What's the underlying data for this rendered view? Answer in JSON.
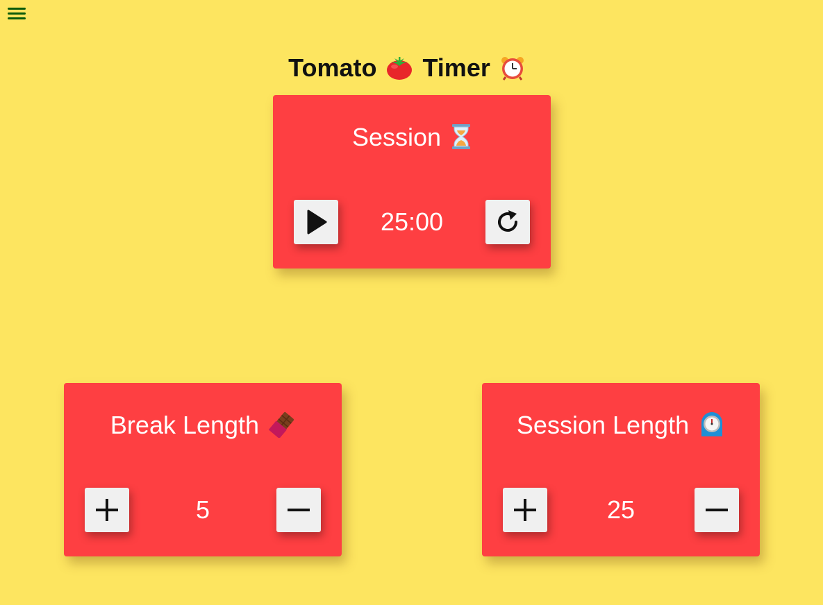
{
  "header": {
    "title_word_1": "Tomato",
    "title_word_2": "Timer",
    "tomato_icon": "tomato-icon",
    "alarm_icon": "alarm-clock-icon"
  },
  "menu": {
    "icon": "hamburger-menu-icon",
    "color": "#0a5a0a"
  },
  "session": {
    "label": "Session",
    "icon": "hourglass-icon",
    "time": "25:00",
    "play_icon": "play-icon",
    "reset_icon": "refresh-icon"
  },
  "break_length": {
    "label": "Break Length",
    "icon": "chocolate-bar-icon",
    "value": "5",
    "increment_icon": "plus-icon",
    "decrement_icon": "minus-icon"
  },
  "session_length": {
    "label": "Session Length",
    "icon": "stopwatch-icon",
    "value": "25",
    "increment_icon": "plus-icon",
    "decrement_icon": "minus-icon"
  },
  "colors": {
    "background": "#fde560",
    "card": "#fe3f42",
    "button": "#f0f0f0",
    "text_light": "#ffffff",
    "text_dark": "#111111"
  }
}
